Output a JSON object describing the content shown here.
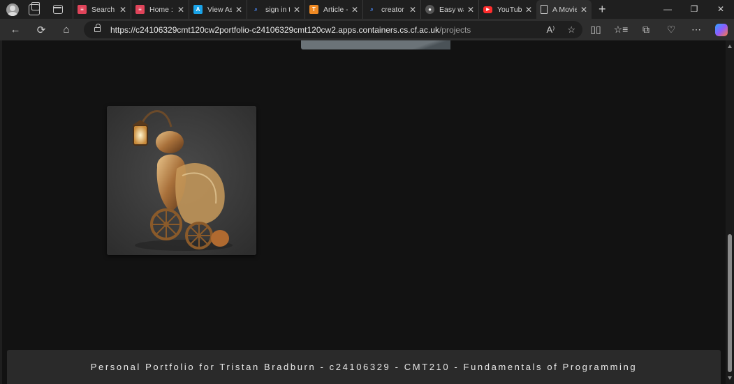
{
  "browser": {
    "tabs": [
      {
        "title": "Search",
        "favicon": "list-favicon",
        "color": "#e0445a",
        "active": false
      },
      {
        "title": "Home :",
        "favicon": "list-favicon",
        "color": "#e0445a",
        "active": false
      },
      {
        "title": "View As",
        "favicon": "app-favicon",
        "color": "#1aa3e8",
        "active": false
      },
      {
        "title": "sign in t",
        "favicon": "search-favicon",
        "color": "#4c8dff",
        "active": false
      },
      {
        "title": "Article -",
        "favicon": "t-favicon",
        "color": "#f08a24",
        "active": false
      },
      {
        "title": "creator",
        "favicon": "search-favicon",
        "color": "#4c8dff",
        "active": false
      },
      {
        "title": "Easy wa",
        "favicon": "dark-favicon",
        "color": "#555555",
        "active": false
      },
      {
        "title": "YouTub",
        "favicon": "youtube-favicon",
        "color": "#ff2d2d",
        "active": false
      },
      {
        "title": "A Movie",
        "favicon": "page-favicon",
        "color": "#cfcfcf",
        "active": true
      }
    ],
    "tab_close": "✕",
    "new_tab": "+",
    "window_controls": {
      "minimize": "—",
      "restore": "❐",
      "close": "✕"
    },
    "nav": {
      "back": "←",
      "reload": "⟳",
      "home": "⌂"
    },
    "url": {
      "main": "https://c24106329cmt120cw2portfolio-c24106329cmt120cw2.apps.containers.cs.cf.ac.uk",
      "path": "/projects"
    },
    "omnibox_actions": {
      "read_aloud": "A⁾",
      "favorite": "☆"
    },
    "toolbar": {
      "split": "▯▯",
      "favorites": "☆≡",
      "collections": "⧉",
      "browser_essentials": "♡",
      "more": "⋯"
    }
  },
  "page": {
    "footer_text": "Personal Portfolio for Tristan Bradburn - c24106329 - CMT210 - Fundamentals of Programming"
  },
  "colors": {
    "page_bg": "#121212",
    "footer_bg": "#2a2a2a",
    "chrome_bg": "#1f1f1f",
    "toolbar_bg": "#2e2e2e"
  }
}
